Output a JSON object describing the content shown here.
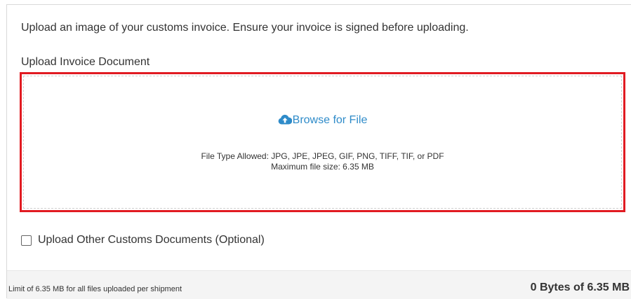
{
  "instructions": "Upload an image of your customs invoice. Ensure your invoice is signed before uploading.",
  "invoice_upload": {
    "label": "Upload Invoice Document",
    "browse_icon": "cloud-upload-icon",
    "browse_label": "Browse for File",
    "file_types": "File Type Allowed: JPG, JPE, JPEG, GIF, PNG, TIFF, TIF, or PDF",
    "max_size": "Maximum file size: 6.35 MB",
    "highlight_color": "#e11b22",
    "link_color": "#2e8bc9"
  },
  "other_documents": {
    "checked": false,
    "label": "Upload Other Customs Documents (Optional)"
  },
  "footer": {
    "limit_text": "Limit of 6.35 MB for all files uploaded per shipment",
    "usage_text": "0 Bytes of 6.35 MB"
  }
}
